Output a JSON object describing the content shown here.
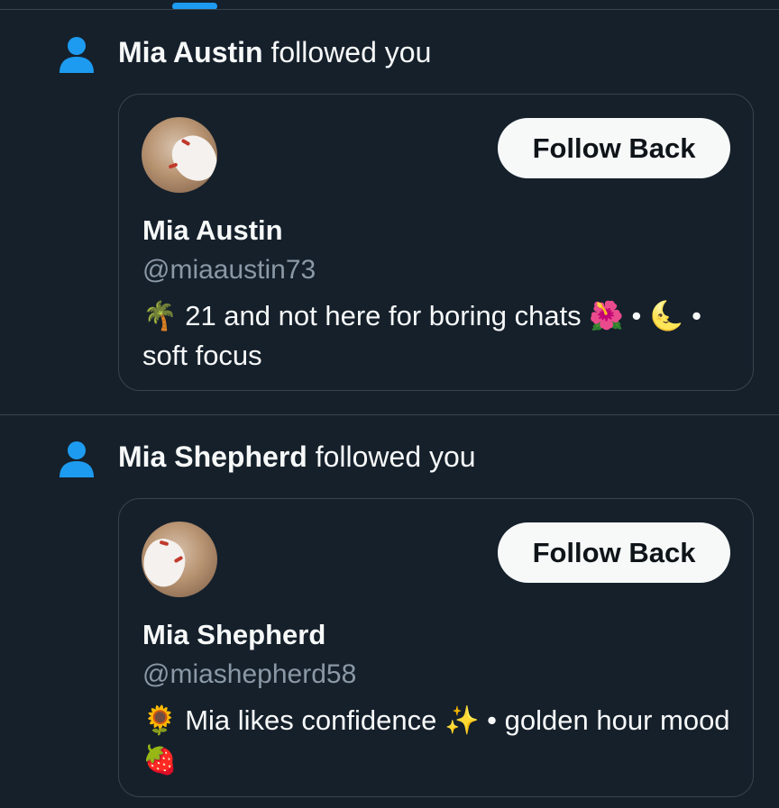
{
  "theme": {
    "background": "#15202b",
    "border": "#38444d",
    "accent": "#1d9bf0",
    "text_primary": "#f7f9f9",
    "text_secondary": "#8b98a5",
    "button_bg": "#f7f9f9",
    "button_text": "#0f1419"
  },
  "notifications": [
    {
      "icon": "person-icon",
      "actor_name": "Mia Austin",
      "action_text": "followed you",
      "card": {
        "display_name": "Mia Austin",
        "handle": "@miaaustin73",
        "bio": "🌴 21 and not here for boring chats 🌺 • 🌜 • soft focus",
        "follow_button_label": "Follow Back"
      }
    },
    {
      "icon": "person-icon",
      "actor_name": "Mia Shepherd",
      "action_text": "followed you",
      "card": {
        "display_name": "Mia Shepherd",
        "handle": "@miashepherd58",
        "bio": "🌻 Mia likes confidence ✨ • golden hour mood 🍓",
        "follow_button_label": "Follow Back"
      }
    }
  ]
}
